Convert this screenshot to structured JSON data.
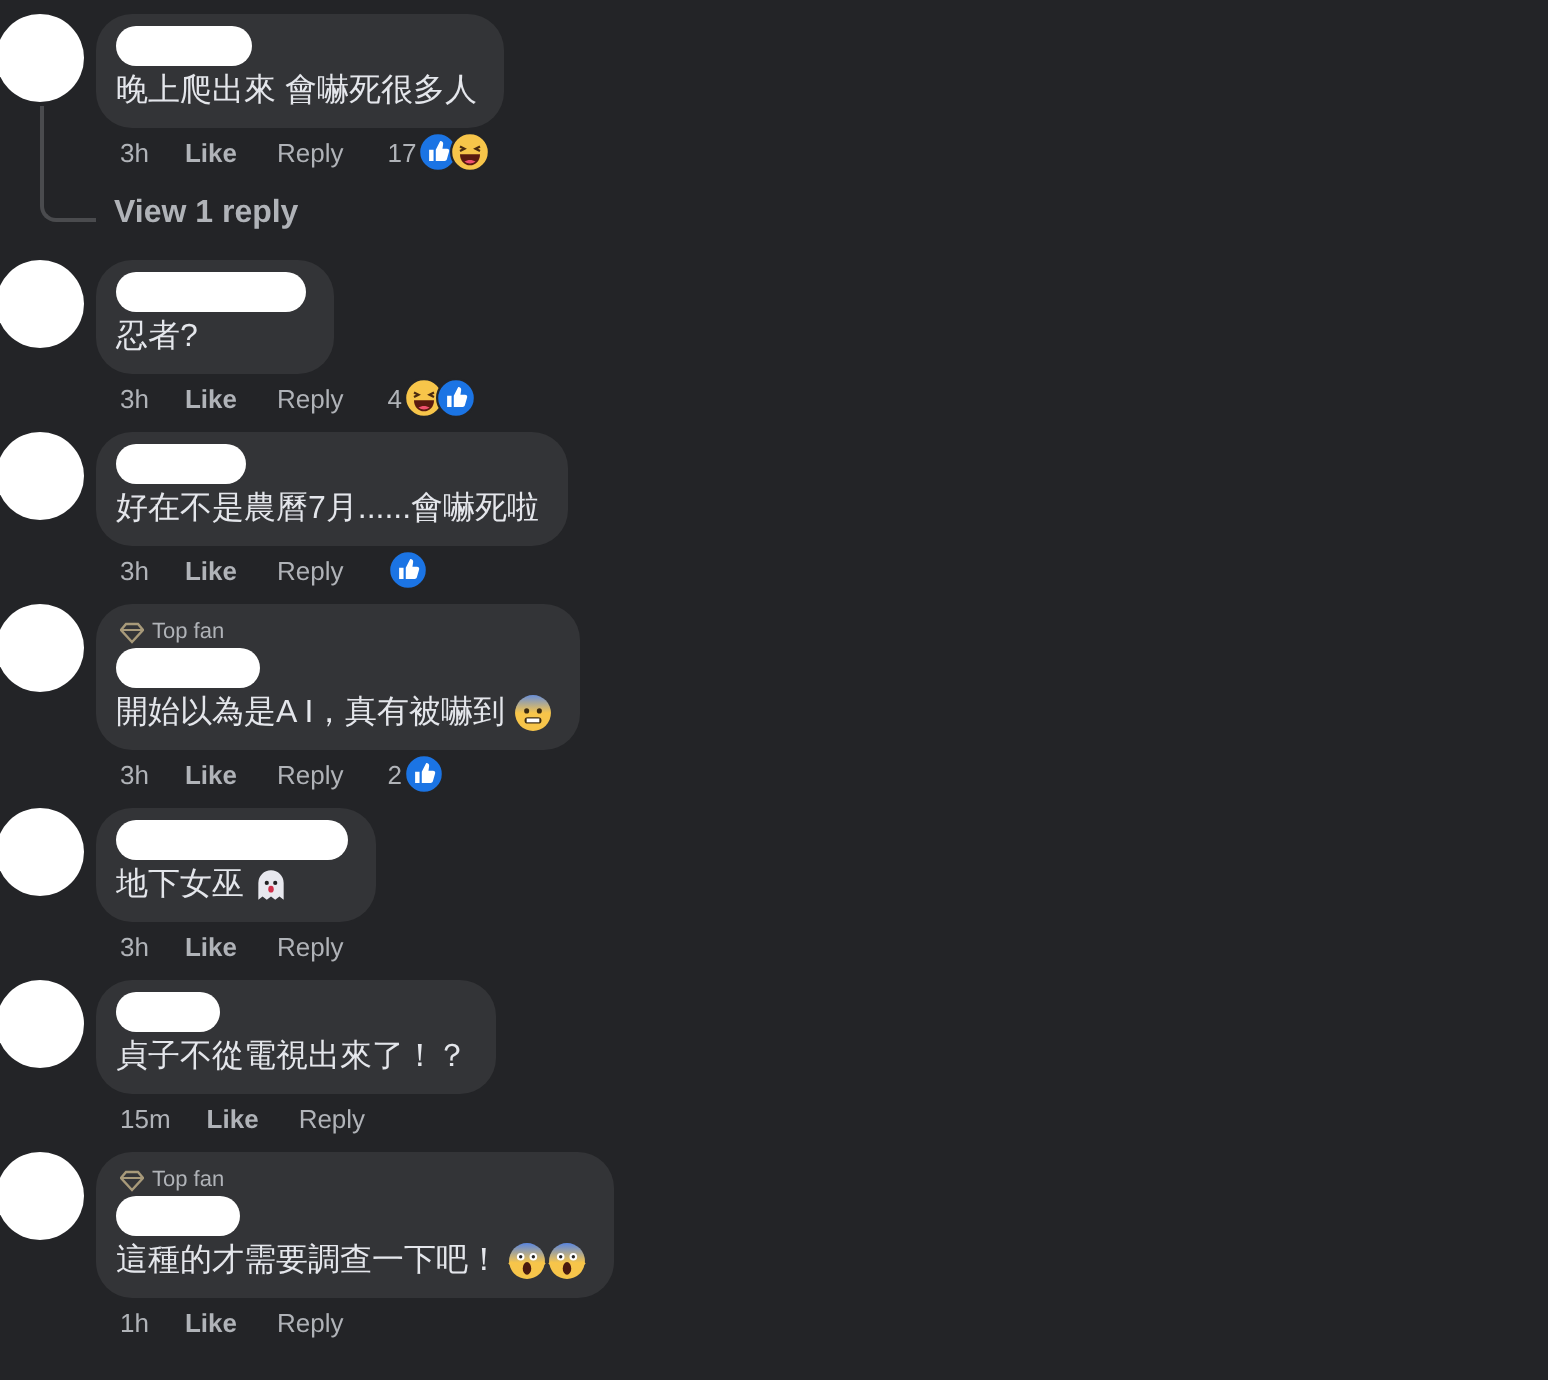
{
  "comments": [
    {
      "text": "晚上爬出來 會嚇死很多人",
      "time": "3h",
      "like": "Like",
      "reply": "Reply",
      "reaction_count": "17",
      "reactions": [
        {
          "kind": "like"
        },
        {
          "kind": "haha"
        }
      ],
      "replies_link": "View 1 reply"
    },
    {
      "text": "忍者?",
      "time": "3h",
      "like": "Like",
      "reply": "Reply",
      "reaction_count": "4",
      "reactions": [
        {
          "kind": "haha"
        },
        {
          "kind": "like"
        }
      ]
    },
    {
      "text": "好在不是農曆7月......會嚇死啦",
      "time": "3h",
      "like": "Like",
      "reply": "Reply",
      "reactions": [
        {
          "kind": "like"
        }
      ]
    },
    {
      "badge": "Top fan",
      "text": "開始以為是A I，真有被嚇到",
      "emojis": [
        {
          "kind": "fearful"
        }
      ],
      "time": "3h",
      "like": "Like",
      "reply": "Reply",
      "reaction_count": "2",
      "reactions": [
        {
          "kind": "like"
        }
      ]
    },
    {
      "text": "地下女巫",
      "emojis": [
        {
          "kind": "ghost"
        }
      ],
      "time": "3h",
      "like": "Like",
      "reply": "Reply"
    },
    {
      "text": "貞子不從電視出來了！？",
      "time": "15m",
      "like": "Like",
      "reply": "Reply"
    },
    {
      "badge": "Top fan",
      "text": "這種的才需要調查一下吧！",
      "emojis": [
        {
          "kind": "scream"
        },
        {
          "kind": "scream"
        }
      ],
      "time": "1h",
      "like": "Like",
      "reply": "Reply"
    }
  ]
}
